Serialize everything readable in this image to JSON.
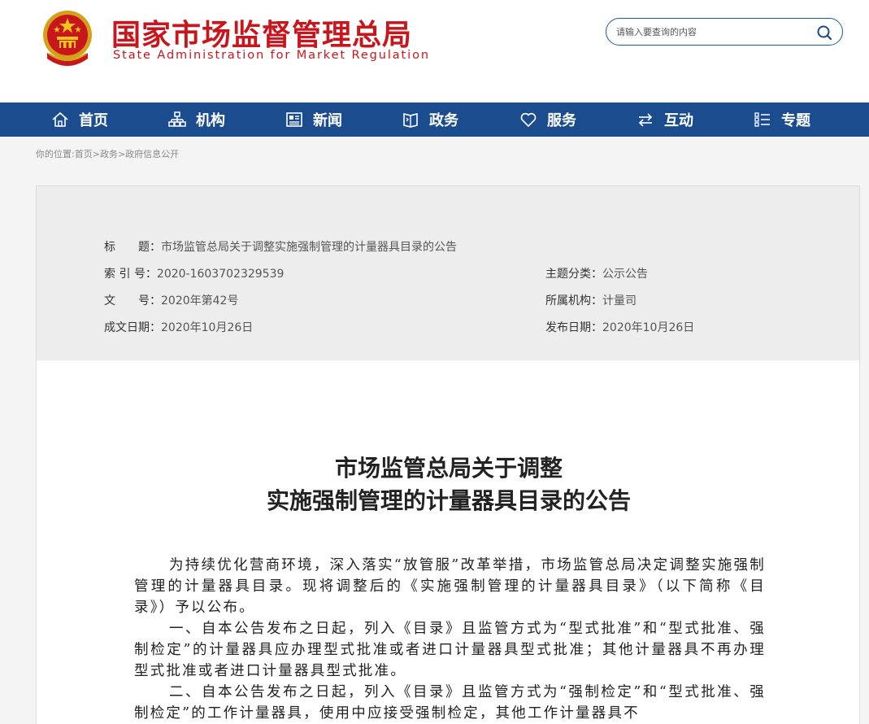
{
  "header": {
    "title": "国家市场监督管理总局",
    "subtitle": "State Administration for Market Regulation",
    "brand_color": "#c8161d",
    "emblem_icon": "national-emblem-icon"
  },
  "search": {
    "placeholder": "请输入要查询的内容",
    "icon": "search-icon"
  },
  "nav": {
    "background": "#1b4d8e",
    "items": [
      {
        "label": "首页",
        "icon": "home-icon"
      },
      {
        "label": "机构",
        "icon": "org-chart-icon"
      },
      {
        "label": "新闻",
        "icon": "news-icon"
      },
      {
        "label": "政务",
        "icon": "book-icon"
      },
      {
        "label": "服务",
        "icon": "heart-icon"
      },
      {
        "label": "互动",
        "icon": "exchange-arrows-icon"
      },
      {
        "label": "专题",
        "icon": "list-icon"
      }
    ]
  },
  "breadcrumb": {
    "prefix": "你的位置:",
    "items": [
      "首页",
      "政务",
      "政府信息公开"
    ],
    "separator": ">"
  },
  "meta": {
    "title_label": "标　　题：",
    "title_value": "市场监管总局关于调整实施强制管理的计量器具目录的公告",
    "index_label": "索 引 号：",
    "index_value": "2020-1603702329539",
    "topic_label": "主题分类：",
    "topic_value": "公示公告",
    "doc_label": "文　　号：",
    "doc_value": "2020年第42号",
    "org_label": "所属机构：",
    "org_value": "计量司",
    "created_label": "成文日期：",
    "created_value": "2020年10月26日",
    "published_label": "发布日期：",
    "published_value": "2020年10月26日"
  },
  "article": {
    "title_line1": "市场监管总局关于调整",
    "title_line2": "实施强制管理的计量器具目录的公告",
    "paragraphs": [
      "为持续优化营商环境，深入落实“放管服”改革举措，市场监管总局决定调整实施强制管理的计量器具目录。现将调整后的《实施强制管理的计量器具目录》（以下简称《目录》）予以公布。",
      "一、自本公告发布之日起，列入《目录》且监管方式为“型式批准”和“型式批准、强制检定”的计量器具应办理型式批准或者进口计量器具型式批准；其他计量器具不再办理型式批准或者进口计量器具型式批准。",
      "二、自本公告发布之日起，列入《目录》且监管方式为“强制检定”和“型式批准、强制检定”的工作计量器具，使用中应接受强制检定，其他工作计量器具不"
    ]
  }
}
